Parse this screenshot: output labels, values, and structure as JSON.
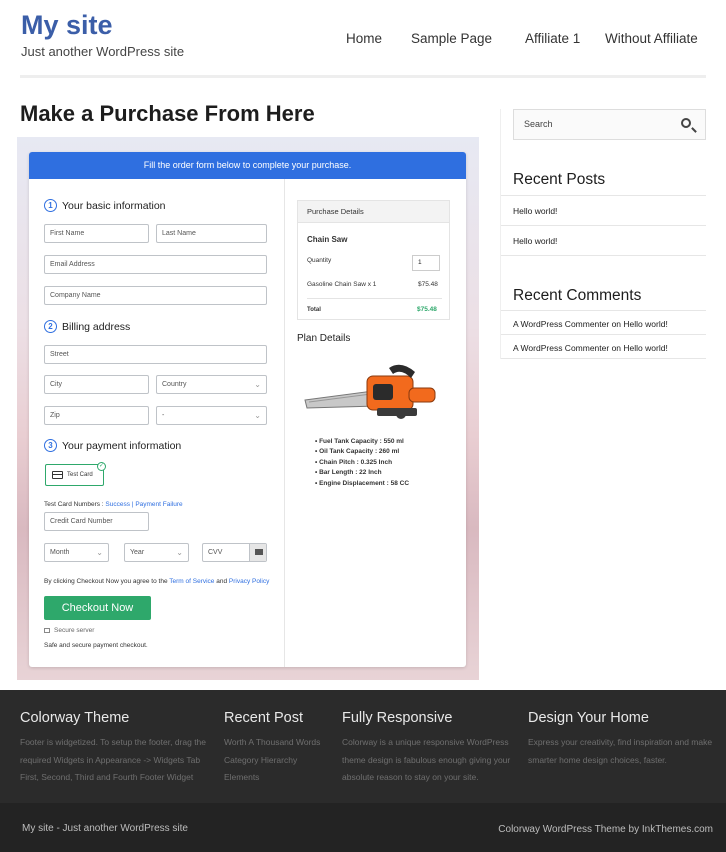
{
  "site": {
    "title": "My site",
    "tagline": "Just another WordPress site"
  },
  "nav": {
    "items": [
      "Home",
      "Sample Page",
      "Affiliate 1",
      "Without Affiliate"
    ]
  },
  "page": {
    "title": "Make a Purchase From Here"
  },
  "checkout": {
    "banner": "Fill the order form below to complete your purchase.",
    "step1": {
      "num": "1",
      "label": "Your basic information"
    },
    "step2": {
      "num": "2",
      "label": "Billing address"
    },
    "step3": {
      "num": "3",
      "label": "Your payment information"
    },
    "placeholders": {
      "first_name": "First Name",
      "last_name": "Last Name",
      "email": "Email Address",
      "company": "Company Name",
      "street": "Street",
      "city": "City",
      "country": "Country",
      "zip": "Zip",
      "state": "-",
      "card_number": "Credit Card Number",
      "month": "Month",
      "year": "Year",
      "cvv": "CVV"
    },
    "payment_option": "Test Card",
    "test_numbers": {
      "label": "Test Card Numbers : ",
      "success": "Success",
      "sep": " | ",
      "failure": "Payment Failure"
    },
    "terms": {
      "prefix": "By clicking Checkout Now you agree to the ",
      "tos": "Term of Service",
      "and": " and ",
      "privacy": "Privacy Policy"
    },
    "button": "Checkout Now",
    "secure": "Secure server",
    "safe": "Safe and secure payment checkout."
  },
  "purchase": {
    "header": "Purchase Details",
    "product": "Chain Saw",
    "qty_label": "Quantity",
    "qty_value": "1",
    "line_item": "Gasoline Chain Saw x 1",
    "line_price": "$75.48",
    "total_label": "Total",
    "total_value": "$75.48",
    "plan_title": "Plan Details",
    "specs": [
      "• Fuel Tank Capacity : 550 ml",
      "• Oil Tank Capacity : 260 ml",
      "• Chain Pitch : 0.325 Inch",
      "• Bar Length : 22 Inch",
      "• Engine Displacement : 58 CC"
    ]
  },
  "sidebar": {
    "search_placeholder": "Search",
    "recent_posts_title": "Recent Posts",
    "recent_posts": [
      "Hello world!",
      "Hello world!"
    ],
    "recent_comments_title": "Recent Comments",
    "comments": [
      {
        "author": "A WordPress Commenter",
        "on": " on ",
        "post": "Hello world!"
      },
      {
        "author": "A WordPress Commenter",
        "on": " on ",
        "post": "Hello world!"
      }
    ]
  },
  "footer": {
    "col1": {
      "title": "Colorway Theme",
      "lines": [
        "Footer is widgetized. To setup the footer, drag the",
        "required Widgets in Appearance -> Widgets Tab",
        "First, Second, Third and Fourth Footer Widget"
      ]
    },
    "col2": {
      "title": "Recent Post",
      "lines": [
        "Worth A Thousand Words",
        "Category Hierarchy",
        "Elements"
      ]
    },
    "col3": {
      "title": "Fully Responsive",
      "lines": [
        "Colorway is a unique responsive WordPress",
        "theme design is fabulous enough giving your",
        "absolute reason to stay on your site."
      ]
    },
    "col4": {
      "title": "Design Your Home",
      "lines": [
        "Express your creativity, find inspiration and make",
        "smarter home design choices, faster."
      ]
    },
    "bottom_left": "My site - Just another WordPress site",
    "bottom_right": "Colorway WordPress Theme by InkThemes.com"
  },
  "colors": {
    "accent_blue": "#2f6fe0",
    "site_title": "#3b5ea8",
    "success_green": "#2ea86b"
  }
}
